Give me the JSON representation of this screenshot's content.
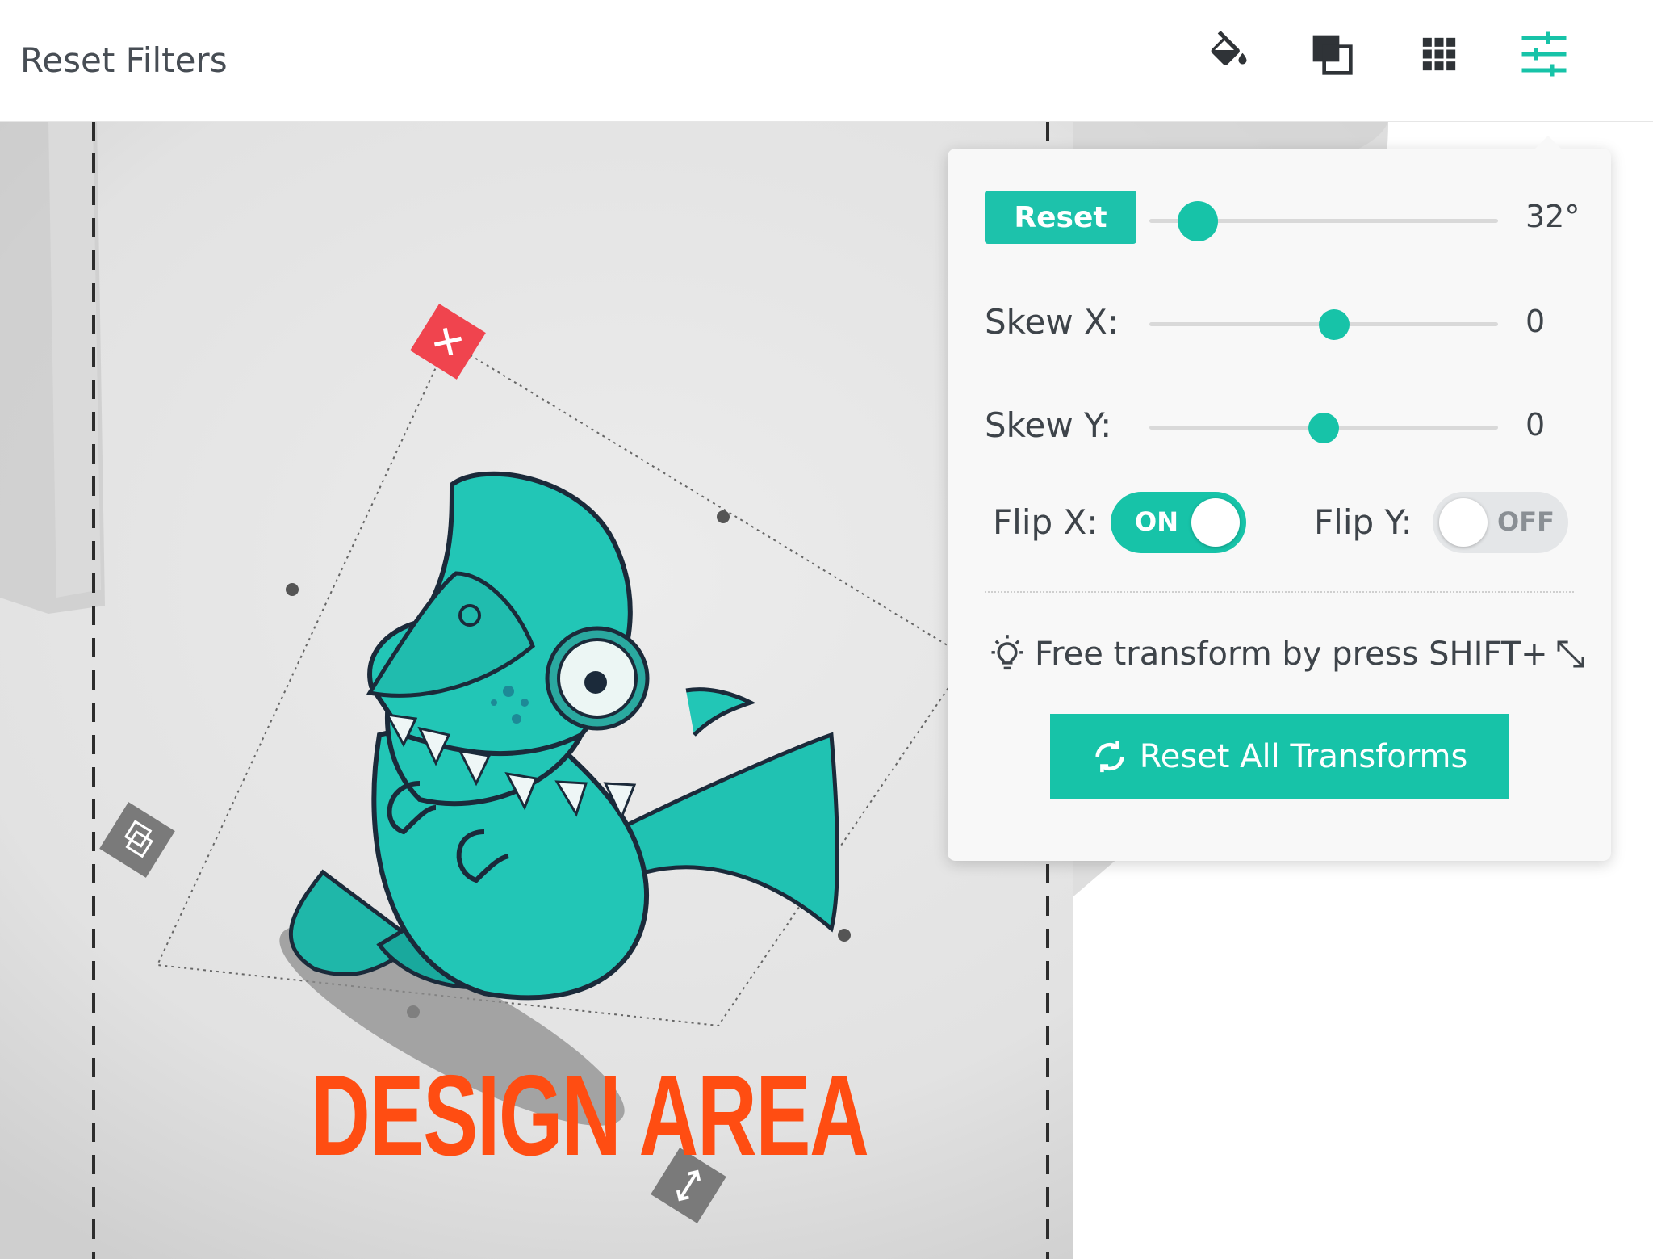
{
  "toolbar": {
    "title": "Reset Filters",
    "icons": [
      "fill-bucket-icon",
      "layers-icon",
      "grid-icon",
      "sliders-icon"
    ],
    "active_icon_color": "#17c3a8"
  },
  "canvas": {
    "design_text": "DESIGN AREA",
    "design_text_color": "#ff4d12"
  },
  "transform_panel": {
    "reset_label": "Reset",
    "rotation_value": "32°",
    "rotation_fraction": 0.14,
    "skew_x": {
      "label": "Skew X:",
      "value": "0",
      "fraction": 0.53
    },
    "skew_y": {
      "label": "Skew Y:",
      "value": "0",
      "fraction": 0.5
    },
    "flip_x": {
      "label": "Flip X:",
      "state": "ON"
    },
    "flip_y": {
      "label": "Flip Y:",
      "state": "OFF"
    },
    "hint": "Free transform by press SHIFT+",
    "reset_all_label": "Reset All Transforms",
    "accent": "#17c3a8"
  }
}
